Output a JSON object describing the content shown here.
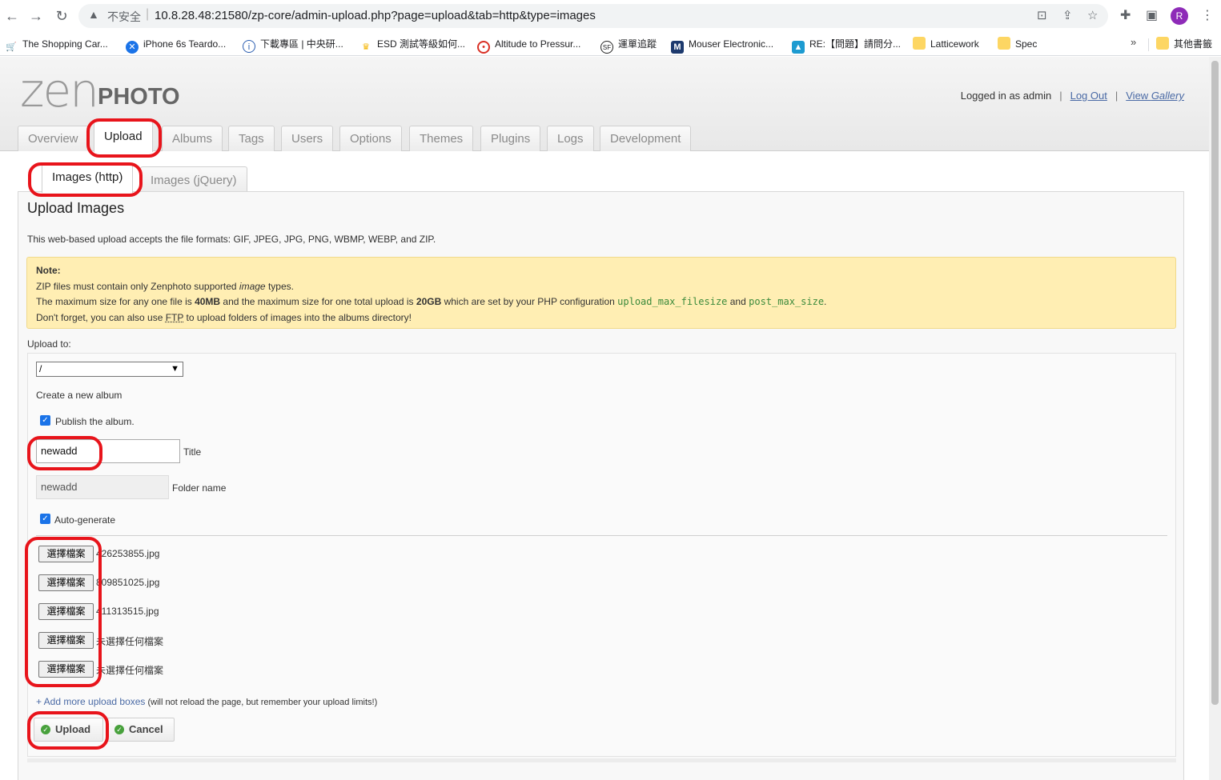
{
  "browser": {
    "insecure_label": "不安全",
    "url": "10.8.28.48:21580/zp-core/admin-upload.php?page=upload&tab=http&type=images",
    "profile_initial": "R",
    "bookmarks": [
      {
        "label": "The Shopping Car...",
        "color": "#f29900"
      },
      {
        "label": "iPhone 6s Teardo...",
        "color": "#1a73e8"
      },
      {
        "label": "下載專區 | 中央研...",
        "color": "#2a5db0"
      },
      {
        "label": "ESD 測試等級如何...",
        "color": "#f4b400"
      },
      {
        "label": "Altitude to Pressur...",
        "color": "#d93025"
      },
      {
        "label": "運單追蹤",
        "color": "#222222"
      },
      {
        "label": "Mouser Electronic...",
        "color": "#1d3a6e"
      },
      {
        "label": "RE:【問題】請問分...",
        "color": "#1d9bd1"
      },
      {
        "label": "Latticework",
        "color": "#fdd663"
      },
      {
        "label": "Spec",
        "color": "#fdd663"
      }
    ],
    "other_bookmarks": "其他書籤"
  },
  "header": {
    "logo_zen": "zen",
    "logo_photo": "PHOTO",
    "logged_in": "Logged in as admin",
    "logout": "Log Out",
    "view_gallery_prefix": "View ",
    "view_gallery_em": "Gallery"
  },
  "tabs": [
    "Overview",
    "Upload",
    "Albums",
    "Tags",
    "Users",
    "Options",
    "Themes",
    "Plugins",
    "Logs",
    "Development"
  ],
  "active_tab": "Upload",
  "subtabs": [
    "Images (http)",
    "Images (jQuery)"
  ],
  "active_subtab": "Images (http)",
  "panel": {
    "title": "Upload Images",
    "description": "This web-based upload accepts the file formats: GIF, JPEG, JPG, PNG, WBMP, WEBP, and ZIP.",
    "note": {
      "heading": "Note:",
      "line1_pre": "ZIP files must contain only Zenphoto supported ",
      "line1_em": "image",
      "line1_post": " types.",
      "line2_pre": "The maximum size for any one file is ",
      "max_file": "40MB",
      "line2_mid": " and the maximum size for one total upload is ",
      "max_total": "20GB",
      "line2_post": " which are set by your PHP configuration ",
      "code1": "upload_max_filesize",
      "and": " and ",
      "code2": "post_max_size",
      "period": ".",
      "line3_pre": "Don't forget, you can also use ",
      "ftp": "FTP",
      "line3_post": " to upload folders of images into the albums directory!"
    },
    "upload_to_label": "Upload to:",
    "album_select_value": "/",
    "create_album_label": "Create a new album",
    "publish_label": "Publish the album.",
    "publish_checked": true,
    "title_value": "newadd",
    "title_label": "Title",
    "folder_value": "newadd",
    "folder_label": "Folder name",
    "autogen_label": "Auto-generate",
    "autogen_checked": true,
    "file_button_label": "選擇檔案",
    "files": [
      "426253855.jpg",
      "809851025.jpg",
      "411313515.jpg",
      "未選擇任何檔案",
      "未選擇任何檔案"
    ],
    "add_more_link": "+ Add more upload boxes",
    "add_more_note": " (will not reload the page, but remember your upload limits!)",
    "upload_button": "Upload",
    "cancel_button": "Cancel"
  },
  "colors": {
    "highlight": "#e8141b",
    "link": "#4a6aa5",
    "note_bg": "#ffeeb3",
    "code": "#3b8a3b",
    "ok_icon": "#48a13c"
  }
}
